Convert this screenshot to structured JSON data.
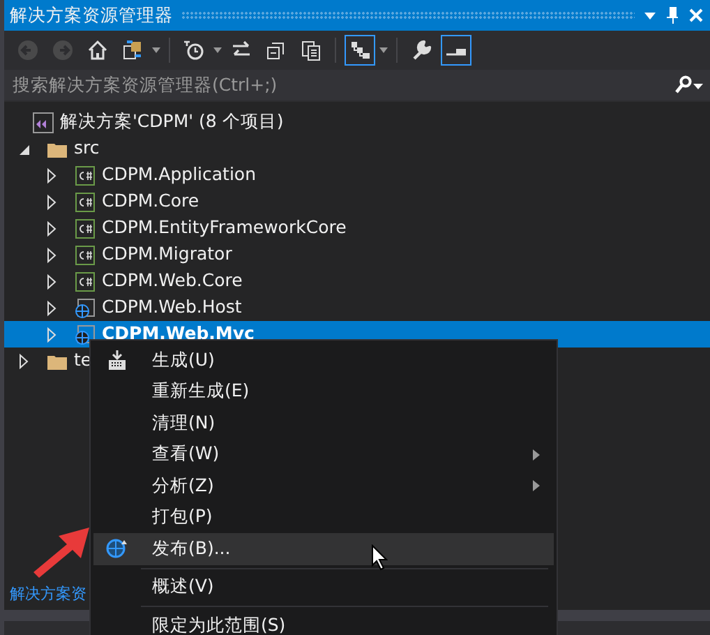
{
  "window": {
    "title": "解决方案资源管理器"
  },
  "toolbar": [
    {
      "kind": "back",
      "disabled": true,
      "on": false
    },
    {
      "kind": "forward",
      "disabled": true,
      "on": false
    },
    {
      "kind": "home",
      "disabled": false,
      "on": false
    },
    {
      "kind": "sync",
      "disabled": false,
      "on": false
    },
    {
      "kind": "caret"
    },
    {
      "kind": "sep"
    },
    {
      "kind": "history",
      "disabled": false,
      "on": false
    },
    {
      "kind": "caret"
    },
    {
      "kind": "swap",
      "disabled": false,
      "on": false
    },
    {
      "kind": "collapse",
      "disabled": false,
      "on": false
    },
    {
      "kind": "copies",
      "disabled": false,
      "on": false
    },
    {
      "kind": "sep"
    },
    {
      "kind": "tree",
      "disabled": false,
      "on": true
    },
    {
      "kind": "caret"
    },
    {
      "kind": "sep"
    },
    {
      "kind": "wrench",
      "disabled": false,
      "on": false
    },
    {
      "kind": "preview",
      "disabled": false,
      "on": true
    }
  ],
  "search": {
    "placeholder": "搜索解决方案资源管理器(Ctrl+;)"
  },
  "tree": [
    {
      "label": "解决方案'CDPM' (8 个项目)",
      "kind": "solution",
      "children": [
        {
          "label": "src",
          "kind": "folder",
          "expanded": true,
          "selected": false,
          "children": [
            {
              "label": "CDPM.Application",
              "kind": "csharp",
              "expanded": false,
              "selected": false
            },
            {
              "label": "CDPM.Core",
              "kind": "csharp",
              "expanded": false,
              "selected": false
            },
            {
              "label": "CDPM.EntityFrameworkCore",
              "kind": "csharp",
              "expanded": false,
              "selected": false
            },
            {
              "label": "CDPM.Migrator",
              "kind": "csharp",
              "expanded": false,
              "selected": false
            },
            {
              "label": "CDPM.Web.Core",
              "kind": "csharp",
              "expanded": false,
              "selected": false
            },
            {
              "label": "CDPM.Web.Host",
              "kind": "web",
              "expanded": false,
              "selected": false
            },
            {
              "label": "CDPM.Web.Mvc",
              "kind": "web",
              "expanded": false,
              "selected": true
            }
          ]
        },
        {
          "label": "te",
          "kind": "folder",
          "expanded": false,
          "selected": false
        }
      ]
    }
  ],
  "bottom_tabs": [
    {
      "label": "解决方案资",
      "selected": true
    }
  ],
  "context_menu": [
    {
      "kind": "build",
      "label": "生成(U)",
      "submenu": false,
      "highlighted": false
    },
    {
      "kind": "item",
      "label": "重新生成(E)",
      "submenu": false,
      "highlighted": false
    },
    {
      "kind": "item",
      "label": "清理(N)",
      "submenu": false,
      "highlighted": false
    },
    {
      "kind": "item",
      "label": "查看(W)",
      "submenu": true,
      "highlighted": false
    },
    {
      "kind": "item",
      "label": "分析(Z)",
      "submenu": true,
      "highlighted": false
    },
    {
      "kind": "item",
      "label": "打包(P)",
      "submenu": false,
      "highlighted": false
    },
    {
      "kind": "publish",
      "label": "发布(B)...",
      "submenu": false,
      "highlighted": true
    },
    {
      "kind": "separator"
    },
    {
      "kind": "item",
      "label": "概述(V)",
      "submenu": false,
      "highlighted": false
    },
    {
      "kind": "separator"
    },
    {
      "kind": "item",
      "label": "限定为此范围(S)",
      "submenu": false,
      "highlighted": false
    }
  ]
}
